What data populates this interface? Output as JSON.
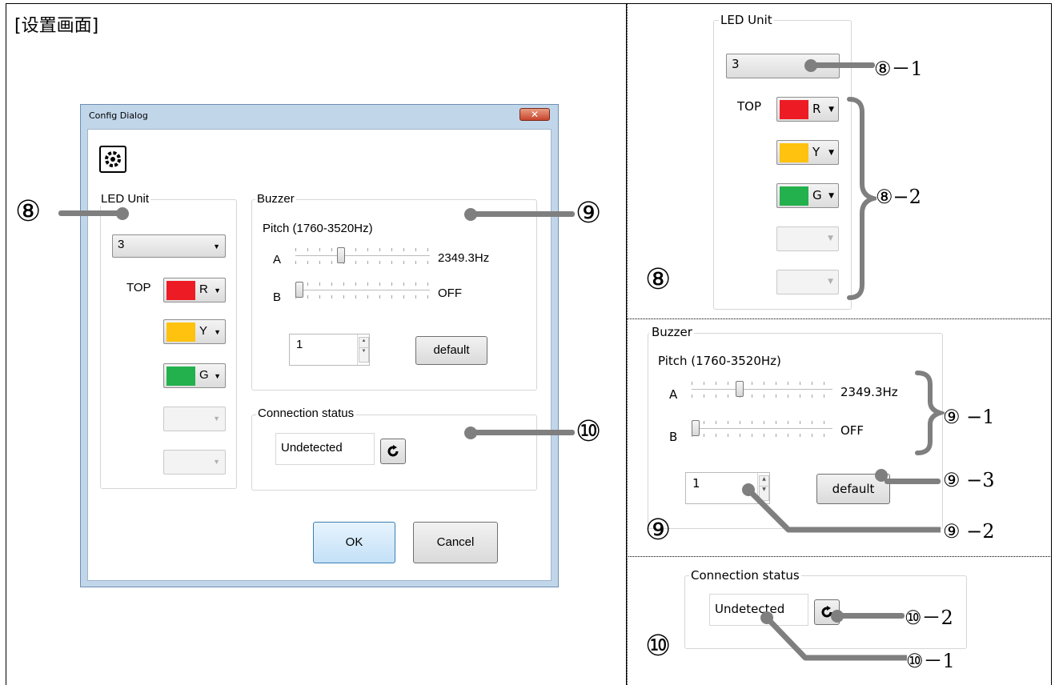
{
  "heading": "[设置画面]",
  "dialog": {
    "title": "Config Dialog",
    "close_icon": "close-icon",
    "led": {
      "legend": "LED Unit",
      "count": "3",
      "top_label": "TOP",
      "slots": [
        {
          "color": "#ed1c24",
          "letter": "R"
        },
        {
          "color": "#ffc20e",
          "letter": "Y"
        },
        {
          "color": "#22b14c",
          "letter": "G"
        }
      ]
    },
    "buzzer": {
      "legend": "Buzzer",
      "pitch_label": "Pitch (1760-3520Hz)",
      "a_label": "A",
      "a_value": "2349.3Hz",
      "a_level": 0.33,
      "b_label": "B",
      "b_value": "OFF",
      "b_level": 0,
      "spin_value": "1",
      "default_label": "default"
    },
    "connection": {
      "legend": "Connection status",
      "status": "Undetected"
    },
    "ok_label": "OK",
    "cancel_label": "Cancel"
  },
  "markers": {
    "m8": "⑧",
    "m9": "⑨",
    "m10": "⑩",
    "m8_1": "⑧－1",
    "m8_2": "⑧−2",
    "m9_1": "⑨  −1",
    "m9_2": "⑨  −2",
    "m9_3": "⑨  −3",
    "m10_1": "⑩－1",
    "m10_2": "⑩－2"
  }
}
